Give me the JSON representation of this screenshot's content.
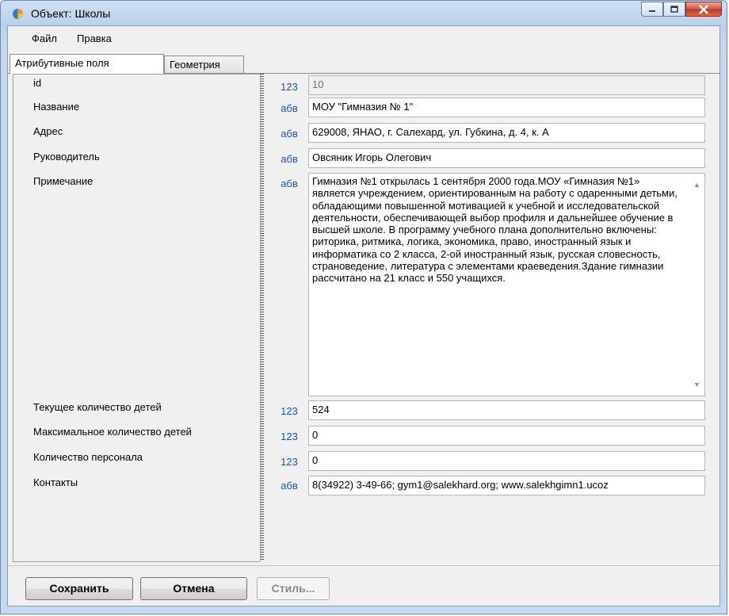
{
  "window": {
    "title": "Объект: Школы",
    "accent_color": "#c4d9ef"
  },
  "menu": {
    "file": "Файл",
    "edit": "Правка"
  },
  "tabs": {
    "attributes": "Атрибутивные поля",
    "geometry": "Геометрия"
  },
  "fields": [
    {
      "label": "id",
      "type": "123",
      "value": "10",
      "readonly": true
    },
    {
      "label": "Название",
      "type": "абв",
      "value": "МОУ \"Гимназия № 1\""
    },
    {
      "label": "Адрес",
      "type": "абв",
      "value": "629008, ЯНАО, г. Салехард, ул. Губкина, д. 4, к. А"
    },
    {
      "label": "Руководитель",
      "type": "абв",
      "value": "Овсяник Игорь Олегович"
    },
    {
      "label": "Примечание",
      "type": "абв",
      "value": "Гимназия №1 открылась 1 сентября 2000 года.МОУ «Гимназия №1» является учреждением, ориентированным на работу с одаренными детьми, обладающими повышенной мотивацией к учебной и исследовательской деятельности, обеспечивающей выбор профиля и дальнейшее обучение в высшей школе. В программу учебного плана дополнительно включены: риторика, ритмика, логика, экономика, право, иностранный язык и информатика со 2 класса, 2-ой иностранный язык, русская словесность, страноведение, литература с элементами краеведения.Здание гимназии рассчитано на 21 класс и 550 учащихся."
    },
    {
      "label": "Текущее количество детей",
      "type": "123",
      "value": "524"
    },
    {
      "label": "Максимальное количество детей",
      "type": "123",
      "value": "0"
    },
    {
      "label": "Количество персонала",
      "type": "123",
      "value": "0"
    },
    {
      "label": "Контакты",
      "type": "абв",
      "value": "8(34922) 3-49-66;  gym1@salekhard.org; www.salekhgimn1.ucoz"
    }
  ],
  "buttons": {
    "save": "Сохранить",
    "cancel": "Отмена",
    "style": "Стиль..."
  }
}
